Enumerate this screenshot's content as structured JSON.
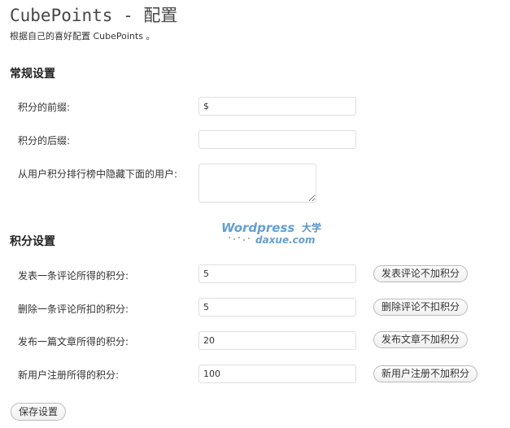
{
  "header": {
    "title": "CubePoints - 配置",
    "description": "根据自己的喜好配置 CubePoints 。"
  },
  "general": {
    "heading": "常规设置",
    "prefix_label": "积分的前缀:",
    "prefix_value": "$",
    "suffix_label": "积分的后缀:",
    "suffix_value": "",
    "hide_users_label": "从用户积分排行榜中隐藏下面的用户:",
    "hide_users_value": ""
  },
  "points": {
    "heading": "积分设置",
    "rows": [
      {
        "label": "发表一条评论所得的积分:",
        "value": "5",
        "button": "发表评论不加积分"
      },
      {
        "label": "删除一条评论所扣的积分:",
        "value": "5",
        "button": "删除评论不扣积分"
      },
      {
        "label": "发布一篇文章所得的积分:",
        "value": "20",
        "button": "发布文章不加积分"
      },
      {
        "label": "新用户注册所得的积分:",
        "value": "100",
        "button": "新用户注册不加积分"
      }
    ]
  },
  "watermark": {
    "line1": "Wordpress",
    "line1_suffix": "大学",
    "line2": "daxue.com",
    "color": "#4a90c8"
  },
  "footer": {
    "save_label": "保存设置"
  }
}
